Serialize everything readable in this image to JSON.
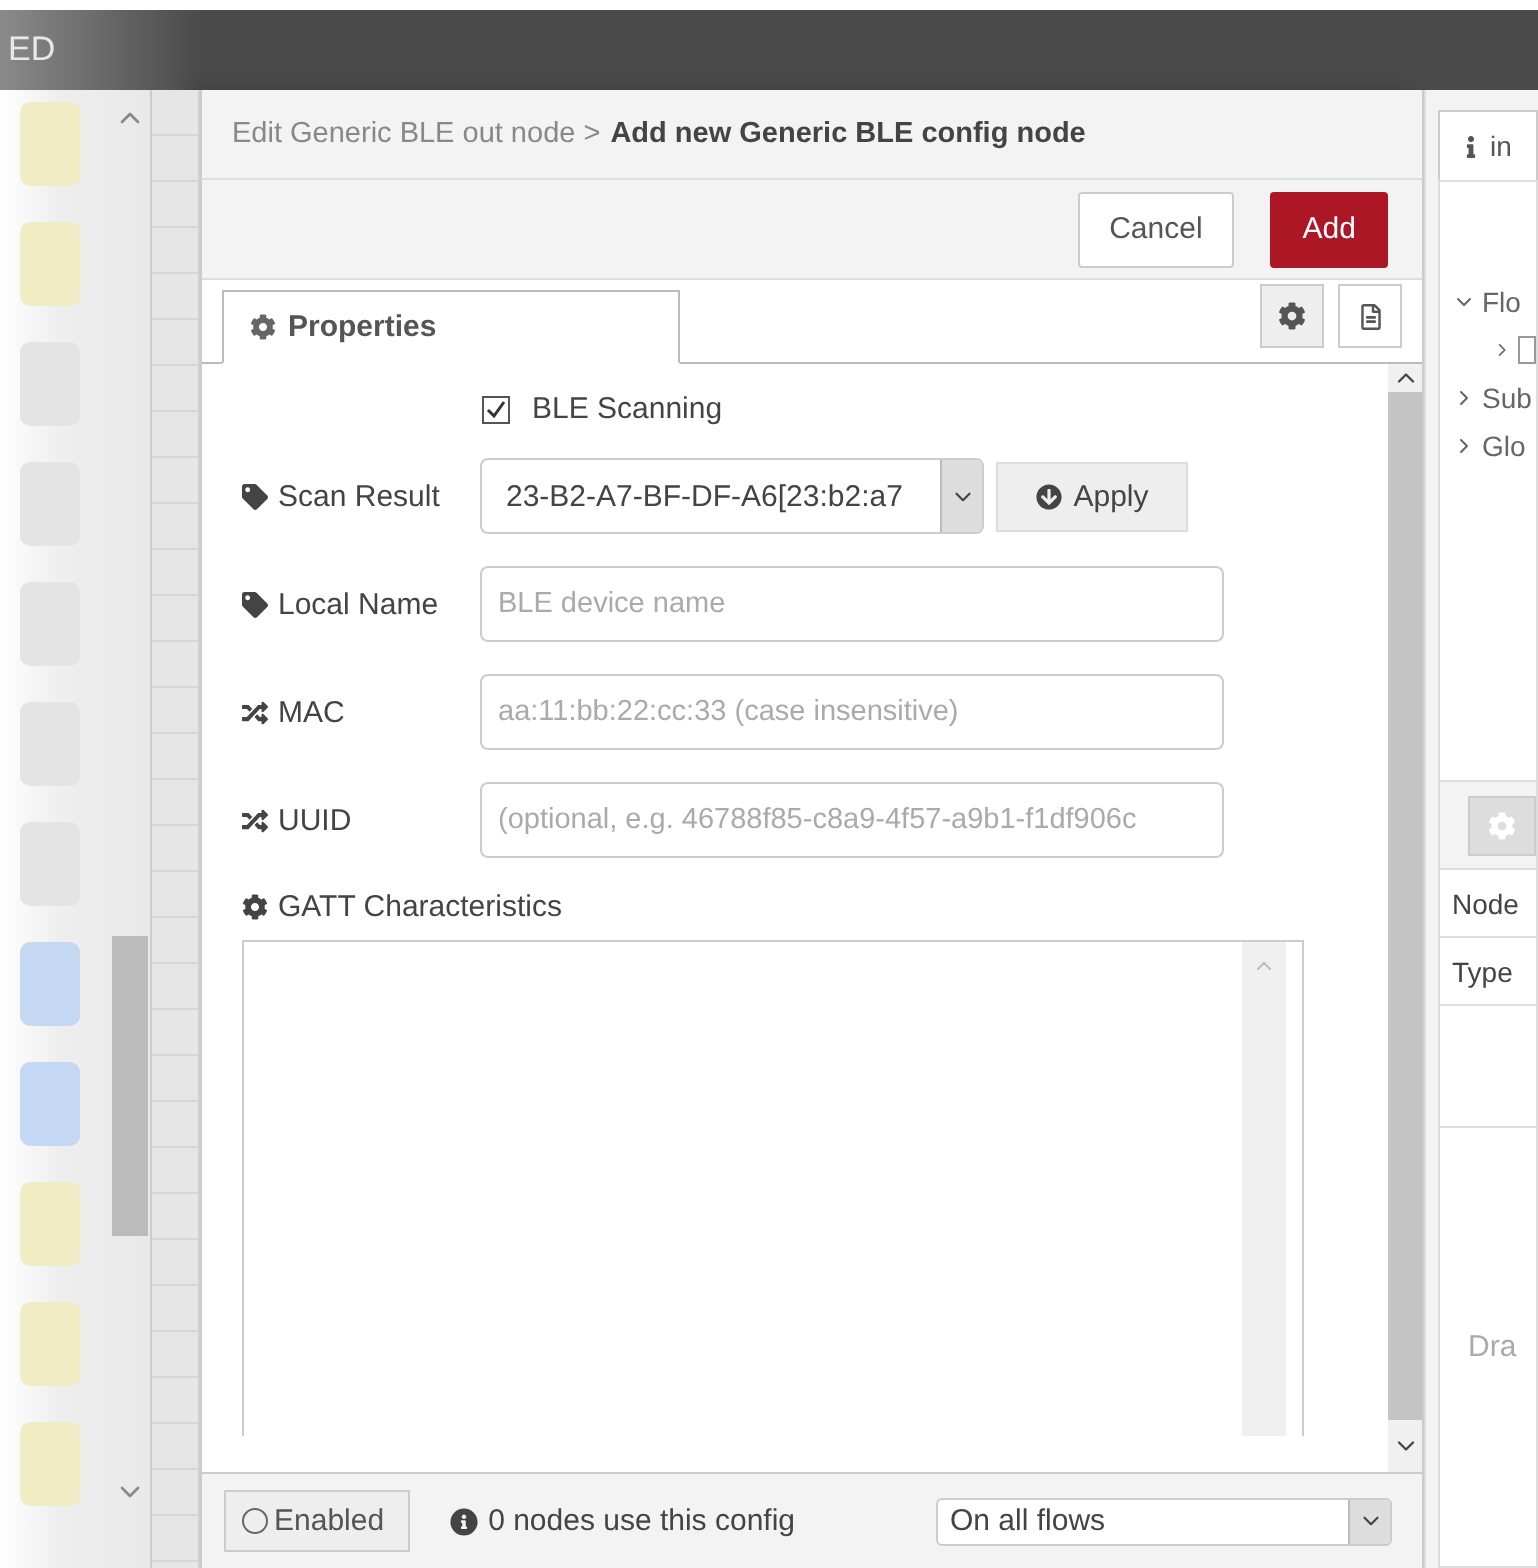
{
  "header": {
    "title": "ED"
  },
  "palette": {
    "nodes": [
      {
        "color": "#f0ecc4"
      },
      {
        "color": "#f0ecc4"
      },
      {
        "color": "#e4e4e4"
      },
      {
        "color": "#e4e4e4"
      },
      {
        "color": "#e4e4e4"
      },
      {
        "color": "#e4e4e4"
      },
      {
        "color": "#e4e4e4"
      },
      {
        "color": "#c4d8f4"
      },
      {
        "color": "#c4d8f4"
      },
      {
        "color": "#f0ecc4"
      },
      {
        "color": "#f0ecc4"
      },
      {
        "color": "#f0ecc4"
      }
    ]
  },
  "dialog": {
    "breadcrumb": "Edit Generic BLE out node >",
    "title": "Add new Generic BLE config node",
    "buttons": [
      {
        "label": "Cancel",
        "kind": "secondary"
      },
      {
        "label": "Add",
        "kind": "primary"
      }
    ],
    "tabs": [
      {
        "label": "Properties",
        "selected": true
      }
    ],
    "form": [
      {
        "kind": "checkbox",
        "label": "BLE Scanning",
        "checked": true
      },
      {
        "kind": "select",
        "label": "Scan Result",
        "value": "23-B2-A7-BF-DF-A6[23:b2:a7",
        "button": "Apply"
      },
      {
        "kind": "input",
        "label": "Local Name",
        "placeholder": "BLE device name"
      },
      {
        "kind": "input",
        "label": "MAC",
        "placeholder": "aa:11:bb:22:cc:33 (case insensitive)"
      },
      {
        "kind": "input",
        "label": "UUID",
        "placeholder": "(optional, e.g. 46788f85-c8a9-4f57-a9b1-f1df906c"
      },
      {
        "kind": "textarea",
        "label": "GATT Characteristics"
      }
    ],
    "footer": {
      "toggle": {
        "label": "Enabled",
        "on": false
      },
      "info": "0 nodes use this config",
      "scope": "On all flows"
    }
  },
  "sidebar": {
    "tab": "in",
    "tree": [
      {
        "label": "Flo",
        "expanded": true,
        "children": [
          {
            "kind": "flow"
          }
        ]
      },
      {
        "label": "Sub",
        "expanded": false
      },
      {
        "label": "Glo",
        "expanded": false
      }
    ],
    "rows": [
      "Node",
      "Type"
    ],
    "hint": "Dra"
  }
}
